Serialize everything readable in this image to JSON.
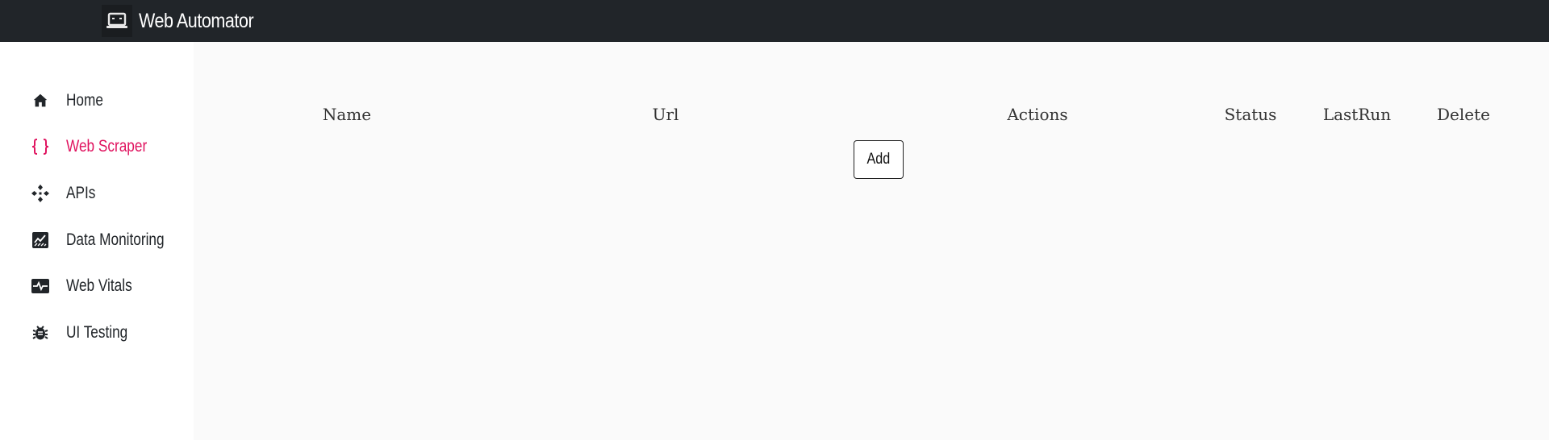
{
  "app": {
    "title": "Web Automator",
    "logo_icon": "laptop-icon"
  },
  "sidebar": {
    "items": [
      {
        "label": "Home",
        "icon": "home-icon",
        "active": false
      },
      {
        "label": "Web Scraper",
        "icon": "curly-braces-icon",
        "active": true
      },
      {
        "label": "APIs",
        "icon": "api-diamond-icon",
        "active": false
      },
      {
        "label": "Data Monitoring",
        "icon": "chart-area-icon",
        "active": false
      },
      {
        "label": "Web Vitals",
        "icon": "heartbeat-icon",
        "active": false
      },
      {
        "label": "UI Testing",
        "icon": "bug-icon",
        "active": false
      }
    ]
  },
  "table": {
    "headers": [
      "Name",
      "Url",
      "Actions",
      "Status",
      "LastRun",
      "Delete"
    ]
  },
  "actions": {
    "add_label": "Add"
  },
  "colors": {
    "topbar": "#212529",
    "accent": "#e0135f",
    "main_bg": "#fafafa"
  }
}
